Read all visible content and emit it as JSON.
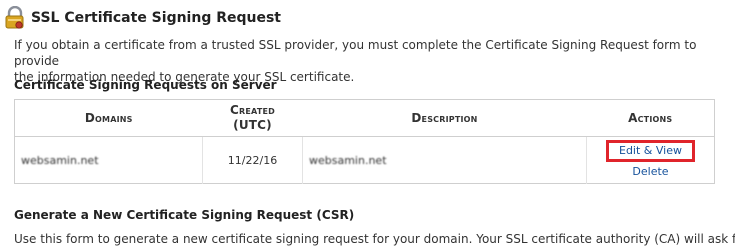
{
  "header": {
    "title": "SSL Certificate Signing Request"
  },
  "intro": {
    "line1": "If you obtain a certificate from a trusted SSL provider, you must complete the Certificate Signing Request form to provide",
    "line2": "the information needed to generate your SSL certificate."
  },
  "csr_section": {
    "title": "Certificate Signing Requests on Server",
    "columns": [
      "Domains",
      "Created (UTC)",
      "Description",
      "Actions"
    ],
    "rows": [
      {
        "domain": "websamin.net",
        "created": "11/22/16",
        "description": "websamin.net",
        "actions": [
          "Edit & View",
          "Delete"
        ]
      }
    ]
  },
  "generate_section": {
    "title": "Generate a New Certificate Signing Request (CSR)",
    "text": "Use this form to generate a new certificate signing request for your domain. Your SSL certificate authority (CA) will ask for"
  },
  "colors": {
    "highlight": "#e0242b",
    "link": "#15519b"
  },
  "icons": {
    "header": "lock-certificate-icon"
  }
}
